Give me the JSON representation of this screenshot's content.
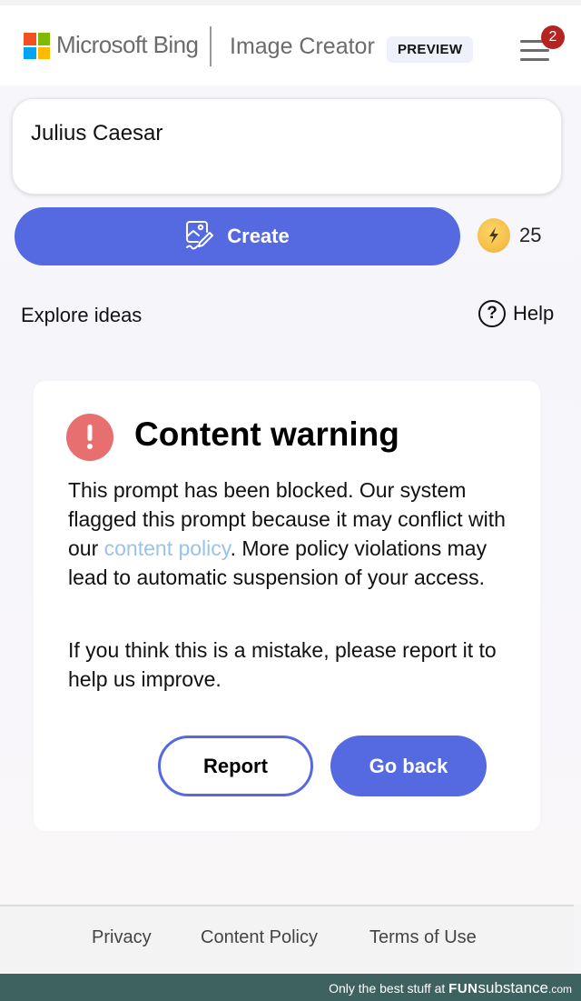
{
  "header": {
    "brand": "Microsoft Bing",
    "app_name": "Image Creator",
    "badge": "PREVIEW",
    "menu_notification_count": "2",
    "logo_colors": [
      "#f25022",
      "#7fba00",
      "#00a4ef",
      "#ffb900"
    ]
  },
  "prompt": {
    "value": "Julius Caesar",
    "placeholder": ""
  },
  "create_button": {
    "label": "Create",
    "icon": "image-paint-icon"
  },
  "boosts": {
    "count": "25",
    "icon": "lightning-bolt-icon"
  },
  "links": {
    "explore": "Explore ideas",
    "help": "Help",
    "help_icon_glyph": "?"
  },
  "warning": {
    "icon_glyph": "!",
    "title": "Content warning",
    "p1_before": "This prompt has been blocked. Our system flagged this prompt because it may conflict with our ",
    "p1_link": "content policy",
    "p1_after": ". More policy violations may lead to automatic suspension of your access.",
    "p2": "If you think this is a mistake, please report it to help us improve.",
    "report_label": "Report",
    "goback_label": "Go back"
  },
  "footer": {
    "links": [
      "Privacy",
      "Content Policy",
      "Terms of Use"
    ]
  },
  "watermark": {
    "prefix": "Only the best stuff at ",
    "brand_bold": "FUN",
    "brand": "substance",
    "tld": ".com"
  },
  "colors": {
    "accent": "#5569e1",
    "warning": "#e86f6f",
    "link": "#9ac3e6",
    "badge": "#b52421"
  }
}
